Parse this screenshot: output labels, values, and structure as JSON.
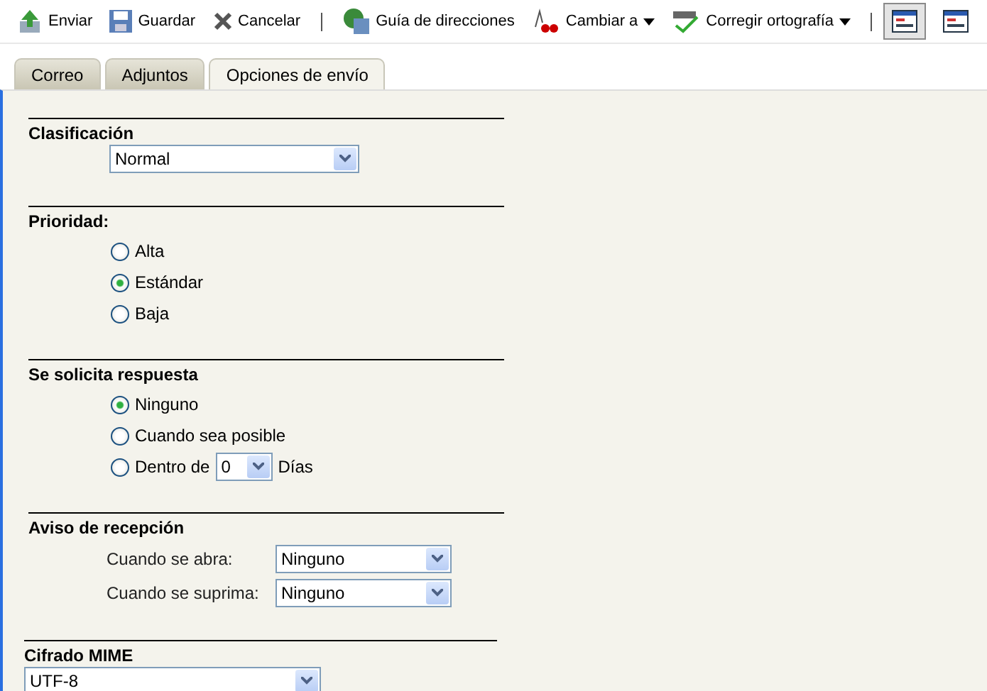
{
  "toolbar": {
    "groups": [
      [
        {
          "label": "Enviar",
          "dropdown": false
        },
        {
          "label": "Guardar",
          "dropdown": false
        },
        {
          "label": "Cancelar",
          "dropdown": false
        }
      ],
      [
        {
          "label": "Guía de direcciones",
          "dropdown": false
        },
        {
          "label": "Cambiar a",
          "dropdown": true
        },
        {
          "label": "Corregir ortografía",
          "dropdown": true
        }
      ]
    ],
    "views": [
      {
        "selected": true
      },
      {
        "selected": false
      }
    ]
  },
  "tabs": [
    {
      "label": "Correo",
      "selected": false
    },
    {
      "label": "Adjuntos",
      "selected": false
    },
    {
      "label": "Opciones de envío",
      "selected": true
    }
  ],
  "sections": [
    {
      "kind": "select",
      "heading": "Clasificación",
      "value": "Normal"
    },
    {
      "kind": "radio",
      "heading": "Prioridad:",
      "options": [
        {
          "label": "Alta",
          "selected": false
        },
        {
          "label": "Estándar",
          "selected": true
        },
        {
          "label": "Baja",
          "selected": false
        }
      ]
    },
    {
      "kind": "radio",
      "heading": "Se solicita respuesta",
      "options": [
        {
          "label": "Ninguno",
          "selected": true
        },
        {
          "label": "Cuando sea posible",
          "selected": false
        },
        {
          "label": "Dentro de",
          "selected": false,
          "select_value": "0",
          "suffix": "Días"
        }
      ]
    },
    {
      "kind": "fields",
      "heading": "Aviso de recepción",
      "fields": [
        {
          "label": "Cuando se abra:",
          "value": "Ninguno"
        },
        {
          "label": "Cuando se suprima:",
          "value": "Ninguno"
        }
      ]
    },
    {
      "kind": "plain_select",
      "heading": "Cifrado MIME",
      "value": "UTF-8"
    }
  ]
}
